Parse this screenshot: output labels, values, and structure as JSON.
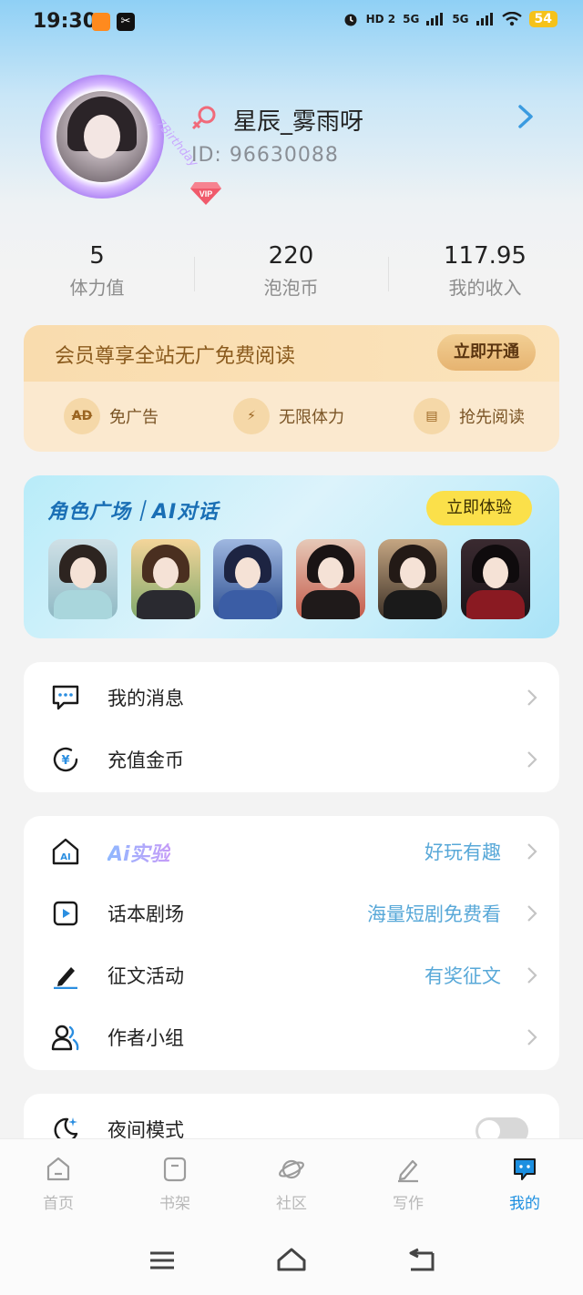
{
  "status_bar": {
    "time": "19:30",
    "app_badge": "✂",
    "network_1": "HD 2",
    "network_2": "5G",
    "network_3": "5G",
    "battery": "54"
  },
  "profile": {
    "username": "星辰_雾雨呀",
    "user_id": "ID: 96630088",
    "vip_label": "VIP",
    "avatar_caption": "7Birthday"
  },
  "stats": [
    {
      "value": "5",
      "label": "体力值"
    },
    {
      "value": "220",
      "label": "泡泡币"
    },
    {
      "value": "117.95",
      "label": "我的收入"
    }
  ],
  "vip_card": {
    "title": "会员尊享全站无广免费阅读",
    "button": "立即开通",
    "benefits": [
      {
        "icon_text": "AD",
        "label": "免广告",
        "icon": "no-ad-icon"
      },
      {
        "icon_text": "⚡",
        "label": "无限体力",
        "icon": "lightning-icon"
      },
      {
        "icon_text": "▤",
        "label": "抢先阅读",
        "icon": "book-icon"
      }
    ]
  },
  "role_card": {
    "title": "角色广场｜AI对话",
    "button": "立即体验"
  },
  "menu_group_1": [
    {
      "label": "我的消息",
      "icon": "message-icon"
    },
    {
      "label": "充值金币",
      "icon": "coin-icon"
    }
  ],
  "menu_group_2": [
    {
      "label": "Ai实验",
      "extra": "好玩有趣",
      "icon": "ai-home-icon"
    },
    {
      "label": "话本剧场",
      "extra": "海量短剧免费看",
      "icon": "play-icon"
    },
    {
      "label": "征文活动",
      "extra": "有奖征文",
      "icon": "pen-icon"
    },
    {
      "label": "作者小组",
      "extra": "",
      "icon": "group-icon"
    }
  ],
  "menu_group_3": [
    {
      "label": "夜间模式",
      "icon": "moon-icon",
      "toggle_on": false
    }
  ],
  "bottom_nav": [
    {
      "label": "首页",
      "icon": "home-icon",
      "active": false
    },
    {
      "label": "书架",
      "icon": "bookshelf-icon",
      "active": false
    },
    {
      "label": "社区",
      "icon": "planet-icon",
      "active": false
    },
    {
      "label": "写作",
      "icon": "write-icon",
      "active": false
    },
    {
      "label": "我的",
      "icon": "profile-chat-icon",
      "active": true
    }
  ],
  "colors": {
    "accent": "#1c8fe0",
    "vip_gold": "#8a5a1d",
    "link_blue": "#58a8d8"
  }
}
